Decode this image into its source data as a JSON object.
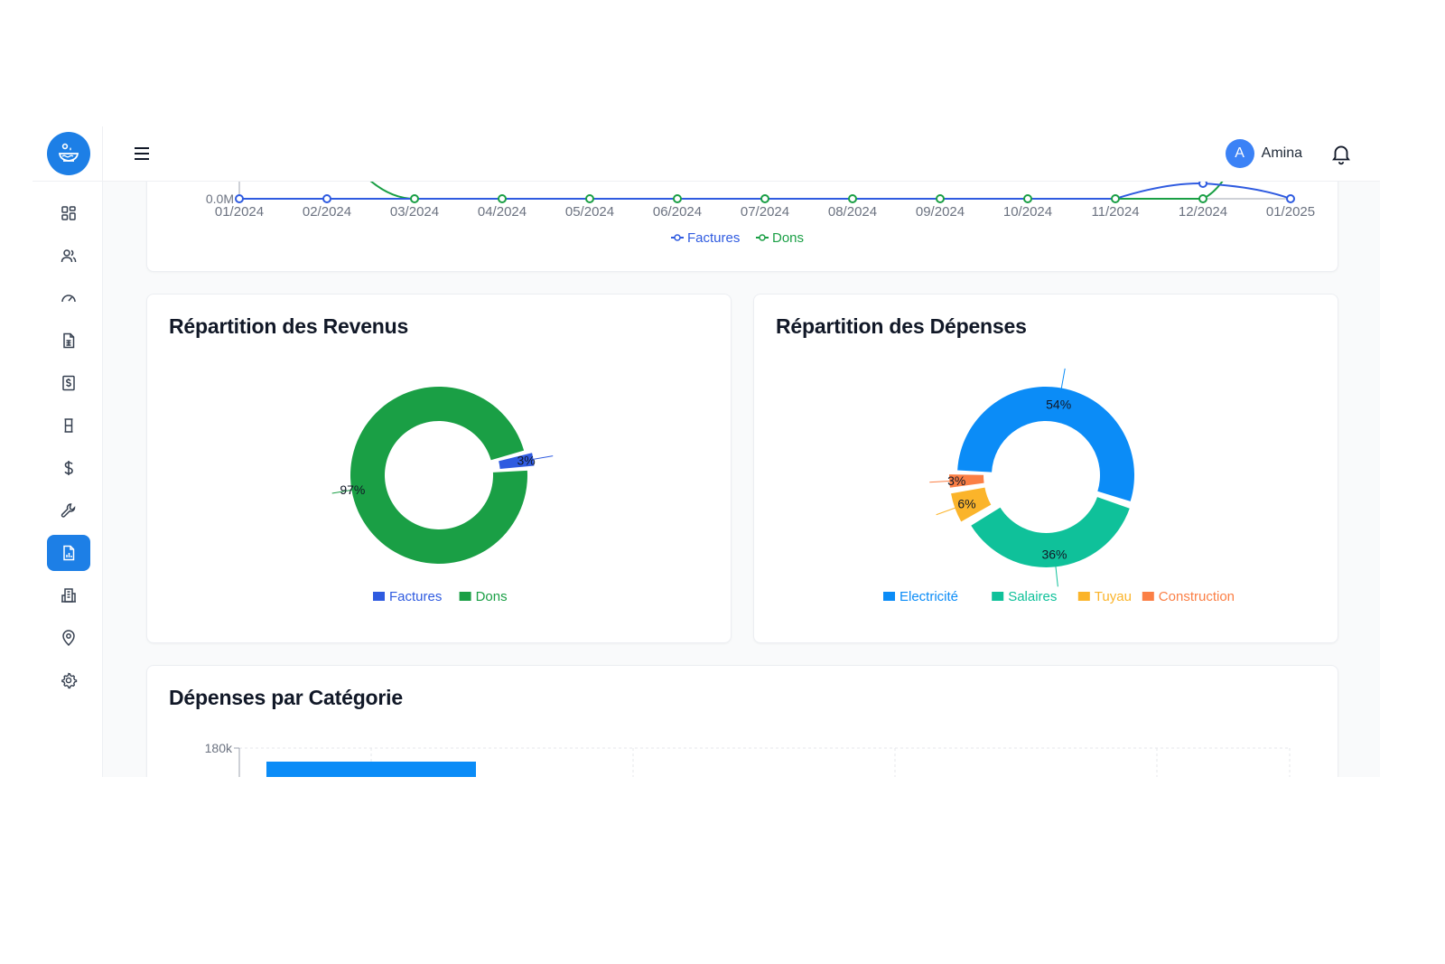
{
  "user": {
    "name": "Amina",
    "avatar_letter": "A"
  },
  "sidebar": {
    "items": [
      {
        "icon": "dashboard-icon",
        "active": false
      },
      {
        "icon": "users-icon",
        "active": false
      },
      {
        "icon": "gauge-icon",
        "active": false
      },
      {
        "icon": "invoice-icon",
        "active": false
      },
      {
        "icon": "dollar-receipt-icon",
        "active": false
      },
      {
        "icon": "tank-icon",
        "active": false
      },
      {
        "icon": "dollar-icon",
        "active": false
      },
      {
        "icon": "wrench-icon",
        "active": false
      },
      {
        "icon": "report-icon",
        "active": true
      },
      {
        "icon": "building-icon",
        "active": false
      },
      {
        "icon": "map-pin-icon",
        "active": false
      },
      {
        "icon": "settings-icon",
        "active": false
      }
    ]
  },
  "colors": {
    "accent": "#1d7fe6",
    "factures": "#2f5be0",
    "dons": "#1a9f45",
    "electricite": "#0b8cf7",
    "salaires": "#0fc19a",
    "tuyau": "#fbb42a",
    "construction": "#fb7f45"
  },
  "chart_data": [
    {
      "type": "line",
      "x": [
        "01/2024",
        "02/2024",
        "03/2024",
        "04/2024",
        "05/2024",
        "06/2024",
        "07/2024",
        "08/2024",
        "09/2024",
        "10/2024",
        "11/2024",
        "12/2024",
        "01/2025"
      ],
      "ylabel_tick": "0.0M",
      "series": [
        {
          "name": "Factures",
          "values": [
            0,
            0,
            0,
            0,
            0,
            0,
            0,
            0,
            0,
            0,
            0,
            null,
            0
          ]
        },
        {
          "name": "Dons",
          "values": [
            null,
            null,
            0,
            0,
            0,
            0,
            0,
            0,
            0,
            0,
            0,
            0,
            null
          ]
        }
      ],
      "legend": "bottom"
    },
    {
      "type": "pie",
      "title": "Répartition des Revenus",
      "labels": [
        "Factures",
        "Dons"
      ],
      "values": [
        3,
        97
      ],
      "value_labels": [
        "3%",
        "97%"
      ],
      "donut": true,
      "legend": "bottom"
    },
    {
      "type": "pie",
      "title": "Répartition des Dépenses",
      "labels": [
        "Electricité",
        "Salaires",
        "Tuyau",
        "Construction"
      ],
      "values": [
        54,
        36,
        6,
        3
      ],
      "value_labels": [
        "54%",
        "36%",
        "6%",
        "3%"
      ],
      "donut": true,
      "legend": "bottom"
    },
    {
      "type": "bar",
      "title": "Dépenses par Catégorie",
      "y_tick_top": "180k",
      "ylim": [
        0,
        180000
      ]
    }
  ]
}
